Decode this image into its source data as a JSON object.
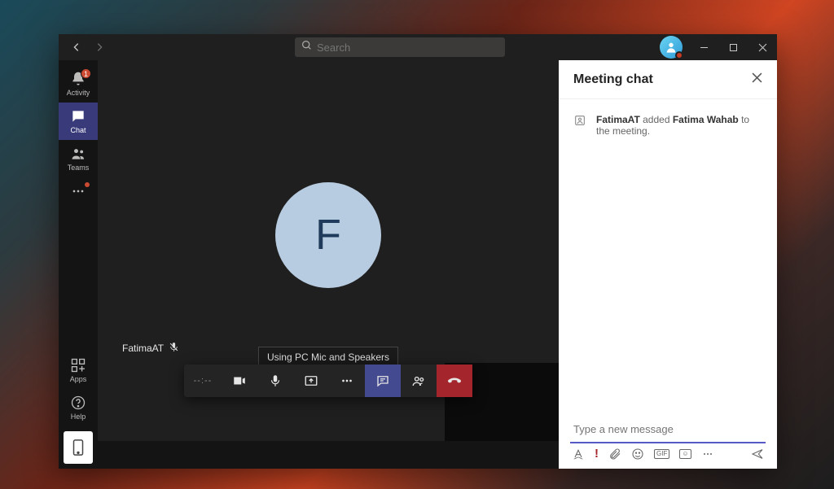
{
  "titlebar": {
    "search_placeholder": "Search"
  },
  "sidebar": {
    "items": [
      {
        "label": "Activity",
        "badge": "1"
      },
      {
        "label": "Chat"
      },
      {
        "label": "Teams"
      }
    ],
    "apps_label": "Apps",
    "help_label": "Help"
  },
  "call": {
    "avatar_initial": "F",
    "participant_name": "FatimaAT",
    "tooltip": "Using PC Mic and Speakers",
    "duration": "--:--"
  },
  "chat": {
    "title": "Meeting chat",
    "system_message": {
      "actor": "FatimaAT",
      "verb": " added ",
      "target": "Fatima Wahab",
      "suffix": " to the meeting."
    },
    "compose_placeholder": "Type a new message",
    "gif_label": "GIF",
    "sticker_label": "☺"
  }
}
